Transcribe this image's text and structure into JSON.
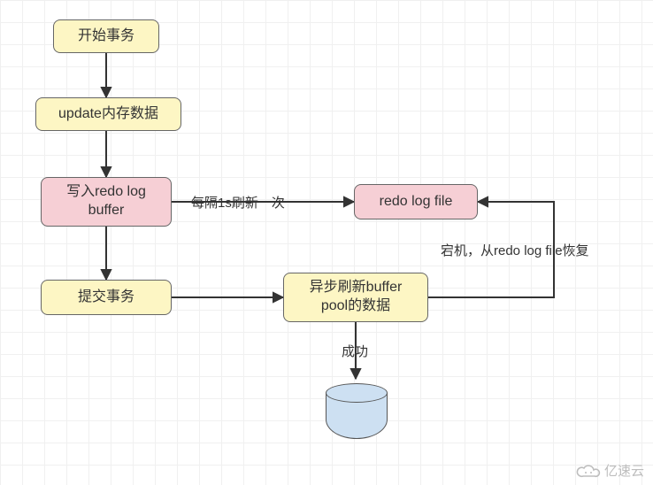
{
  "chart_data": {
    "type": "flowchart",
    "direction": "mixed",
    "nodes": [
      {
        "id": "n1",
        "label": "开始事务",
        "shape": "rounded-rect",
        "fill": "yellow"
      },
      {
        "id": "n2",
        "label": "update内存数据",
        "shape": "rounded-rect",
        "fill": "yellow"
      },
      {
        "id": "n3",
        "label": "写入redo log buffer",
        "shape": "rounded-rect",
        "fill": "pink"
      },
      {
        "id": "n4",
        "label": "redo log file",
        "shape": "rounded-rect",
        "fill": "pink"
      },
      {
        "id": "n5",
        "label": "提交事务",
        "shape": "rounded-rect",
        "fill": "yellow"
      },
      {
        "id": "n6",
        "label": "异步刷新buffer pool的数据",
        "shape": "rounded-rect",
        "fill": "yellow"
      },
      {
        "id": "n7",
        "label": "",
        "shape": "cylinder",
        "fill": "blue"
      }
    ],
    "edges": [
      {
        "from": "n1",
        "to": "n2",
        "label": ""
      },
      {
        "from": "n2",
        "to": "n3",
        "label": ""
      },
      {
        "from": "n3",
        "to": "n5",
        "label": ""
      },
      {
        "from": "n3",
        "to": "n4",
        "label": "每隔1s刷新一次"
      },
      {
        "from": "n5",
        "to": "n6",
        "label": ""
      },
      {
        "from": "n6",
        "to": "n7",
        "label": "成功"
      },
      {
        "from": "n6",
        "to": "n4",
        "label": "宕机，从redo log file恢复"
      }
    ]
  },
  "nodes": {
    "n1": "开始事务",
    "n2": "update内存数据",
    "n3": "写入redo log\nbuffer",
    "n4": "redo log file",
    "n5": "提交事务",
    "n6": "异步刷新buffer\npool的数据",
    "n7_aria": "database cylinder"
  },
  "edge_labels": {
    "n3_n4": "每隔1s刷新一次",
    "n6_n7": "成功",
    "n6_n4": "宕机，从redo log file恢复"
  },
  "watermark": "亿速云"
}
